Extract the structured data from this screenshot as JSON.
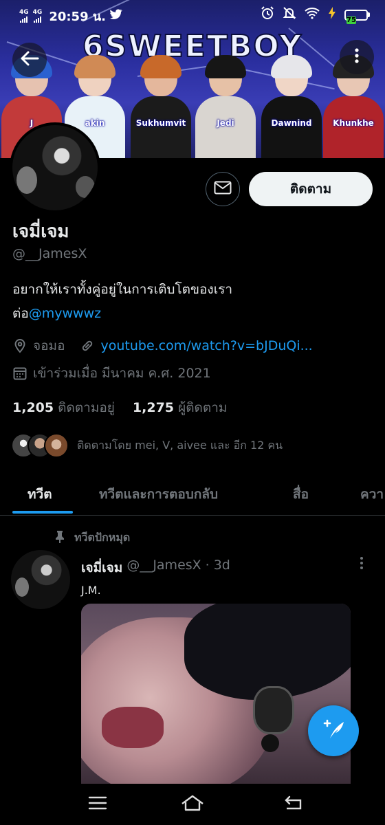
{
  "status_bar": {
    "network_1": "4G",
    "network_2": "4G",
    "time": "20:59 น.",
    "battery": "75",
    "icons": [
      "twitter-bird-icon",
      "alarm-icon",
      "mute-icon",
      "wifi-icon",
      "battery-icon"
    ]
  },
  "header": {
    "banner_title": "6SWEETBOY",
    "members": [
      "J",
      "akin",
      "Sukhumvit",
      "Jedi",
      "Dawnind",
      "Khunkhe"
    ],
    "back_icon": "back-arrow-icon",
    "more_icon": "more-vertical-icon"
  },
  "profile": {
    "display_name": "เจมี่เจม",
    "handle": "@__JamesX",
    "bio_line1": "อยากให้เราทั้งคู่อยู่ในการเติบโตของเรา",
    "bio_prefix": "ต่อ",
    "bio_mention": "@mywwwz",
    "location": "จอมอ",
    "website": "youtube.com/watch?v=bJDuQi...",
    "joined": "เข้าร่วมเมื่อ มีนาคม ค.ศ. 2021",
    "following_count": "1,205",
    "following_label": "ติดตามอยู่",
    "followers_count": "1,275",
    "followers_label": "ผู้ติดตาม",
    "followed_by": "ติดตามโดย mei, V, aivee และ อีก 12 คน",
    "follow_button": "ติดตาม",
    "message_icon": "mail-icon"
  },
  "tabs": [
    {
      "label": "ทวีต",
      "active": true
    },
    {
      "label": "ทวีตและการตอบกลับ",
      "active": false
    },
    {
      "label": "สื่อ",
      "active": false
    },
    {
      "label": "ควา",
      "active": false
    }
  ],
  "pinned_tweet": {
    "pinned_label": "ทวีตปักหมุด",
    "author_name": "เจมี่เจม",
    "author_handle": "@__JamesX",
    "separator": "·",
    "time": "3d",
    "text": "J.M."
  },
  "colors": {
    "accent": "#1d9bf0",
    "background": "#000000",
    "secondary_text": "#71767b",
    "primary_text": "#e7e9ea",
    "battery_fill": "#3ecf3e"
  },
  "navigation": {
    "icons": [
      "recents-icon",
      "home-icon",
      "back-nav-icon"
    ]
  },
  "compose_icon": "compose-tweet-icon"
}
